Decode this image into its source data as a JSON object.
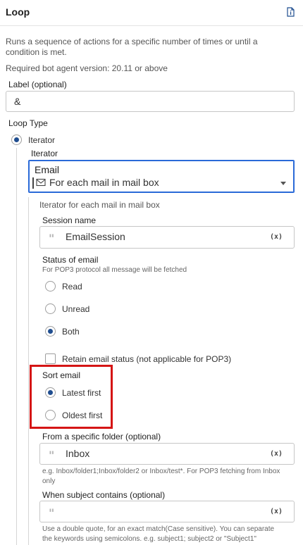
{
  "header": {
    "title": "Loop",
    "doc_icon": "document-info-icon"
  },
  "description": "Runs a sequence of actions for a specific number of times or until a condition is met.",
  "required_version": "Required bot agent version: 20.11 or above",
  "label_field": {
    "label": "Label (optional)",
    "value": "&"
  },
  "loop_type": {
    "label": "Loop Type",
    "option": "Iterator",
    "iterator_label": "Iterator",
    "select": {
      "category": "Email",
      "value": "For each mail in mail box",
      "icon": "envelope-icon"
    },
    "description": "Iterator for each mail in mail box"
  },
  "session": {
    "label": "Session name",
    "value": "EmailSession",
    "var_btn": "(x)"
  },
  "status": {
    "label": "Status of email",
    "hint": "For POP3 protocol all message will be fetched",
    "options": [
      "Read",
      "Unread",
      "Both"
    ],
    "selected": "Both"
  },
  "retain": {
    "label": "Retain email status (not applicable for POP3)",
    "checked": false
  },
  "sort": {
    "label": "Sort email",
    "options": [
      "Latest first",
      "Oldest first"
    ],
    "selected": "Latest first"
  },
  "folder": {
    "label": "From a specific folder (optional)",
    "value": "Inbox",
    "var_btn": "(x)",
    "hint": "e.g. Inbox/folder1;Inbox/folder2 or Inbox/test*. For POP3 fetching from Inbox only"
  },
  "subject": {
    "label": "When subject contains (optional)",
    "value": "",
    "var_btn": "(x)",
    "hint": "Use a double quote, for an exact match(Case sensitive). You can separate the keywords using semicolons. e.g. subject1; subject2 or \"Subject1\""
  },
  "colors": {
    "accent": "#1f4d8f",
    "focus": "#2a6ad8",
    "highlight": "#d51515"
  }
}
